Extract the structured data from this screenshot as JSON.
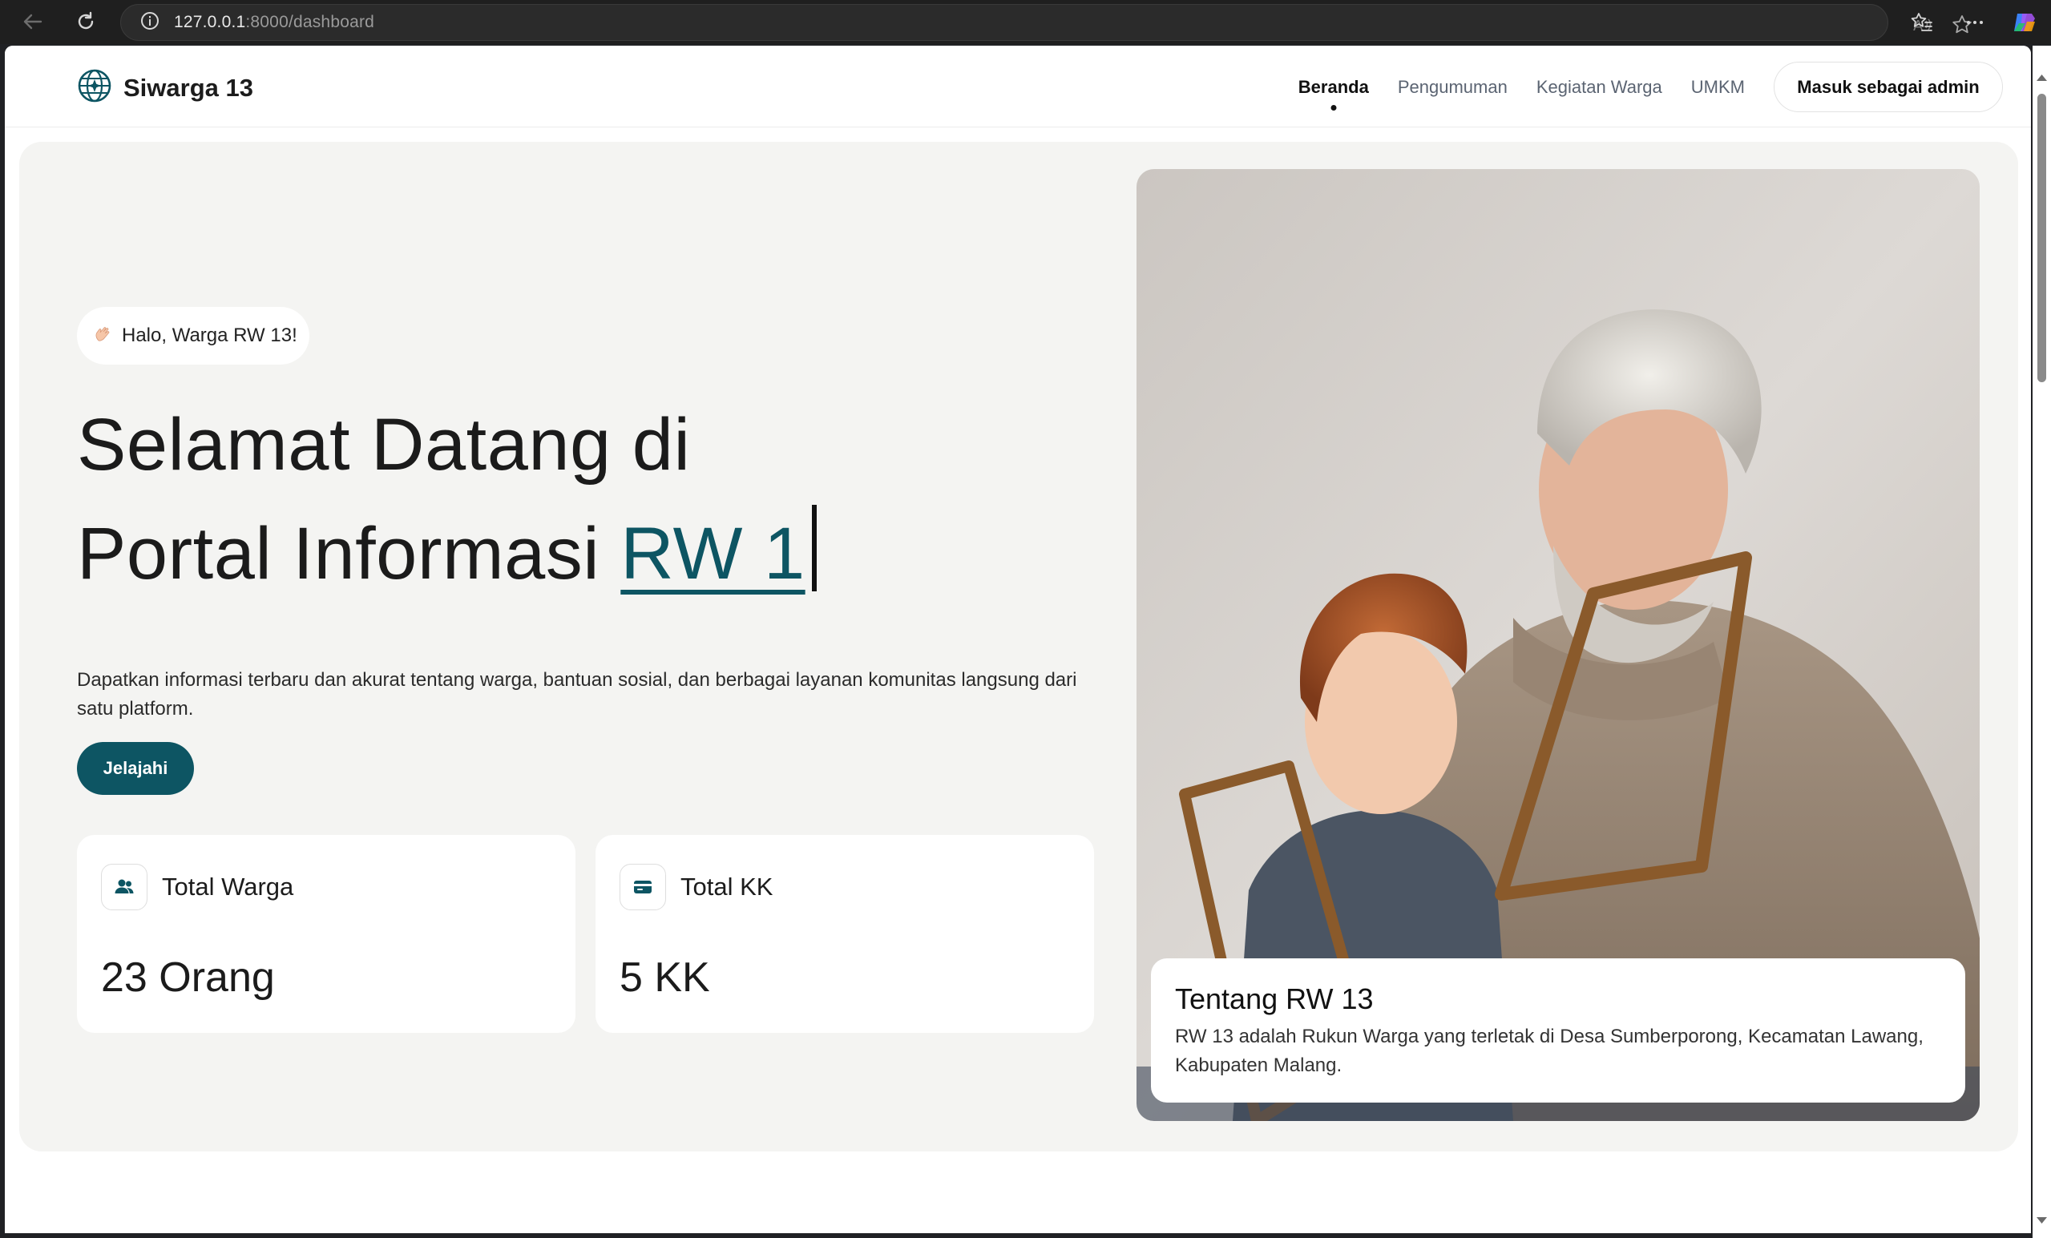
{
  "browser": {
    "url_host": "127.0.0.1",
    "url_path": ":8000/dashboard",
    "icons": [
      "back-arrow-icon",
      "reload-icon",
      "site-info-icon",
      "read-aloud-icon",
      "favorite-star-icon",
      "favorites-icon",
      "more-icon",
      "copilot-icon"
    ]
  },
  "header": {
    "brand": "Siwarga 13",
    "nav": [
      {
        "label": "Beranda",
        "active": true
      },
      {
        "label": "Pengumuman",
        "active": false
      },
      {
        "label": "Kegiatan Warga",
        "active": false
      },
      {
        "label": "UMKM",
        "active": false
      }
    ],
    "admin_button": "Masuk sebagai admin"
  },
  "hero": {
    "greeting": "Halo, Warga RW 13!",
    "headline_line1": "Selamat Datang di",
    "headline_line2_prefix": "Portal Informasi",
    "headline_accent": "RW 1",
    "lead": "Dapatkan informasi terbaru dan akurat tentang warga, bantuan sosial, dan berbagai layanan komunitas langsung dari satu platform.",
    "explore_button": "Jelajahi"
  },
  "stats": [
    {
      "title": "Total Warga",
      "value": "23 Orang",
      "icon": "users-icon"
    },
    {
      "title": "Total KK",
      "value": "5 KK",
      "icon": "card-icon"
    }
  ],
  "about": {
    "title": "Tentang RW 13",
    "text": "RW 13 adalah Rukun Warga yang terletak di Desa Sumberporong, Kecamatan Lawang, Kabupaten Malang."
  },
  "colors": {
    "accent": "#0d5563",
    "hero_bg": "#f4f4f2"
  }
}
